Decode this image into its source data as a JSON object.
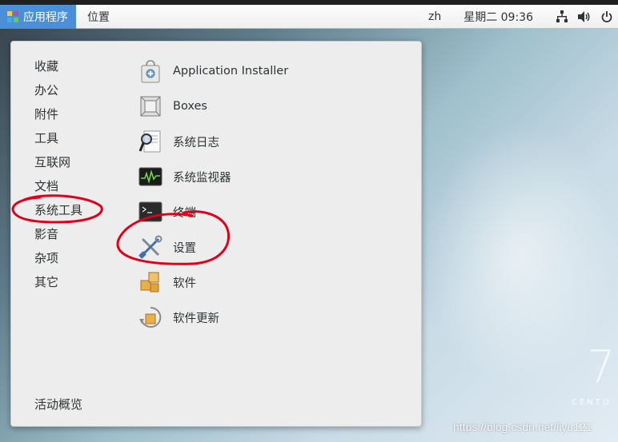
{
  "top_bar": {
    "apps_label": "应用程序",
    "places_label": "位置",
    "language": "zh",
    "clock": "星期二 09:36"
  },
  "categories": [
    "收藏",
    "办公",
    "附件",
    "工具",
    "互联网",
    "文档",
    "系统工具",
    "影音",
    "杂项",
    "其它"
  ],
  "apps": [
    {
      "label": "Application Installer",
      "icon": "application-installer-icon"
    },
    {
      "label": "Boxes",
      "icon": "boxes-icon"
    },
    {
      "label": "系统日志",
      "icon": "system-log-icon"
    },
    {
      "label": "系统监视器",
      "icon": "system-monitor-icon"
    },
    {
      "label": "终端",
      "icon": "terminal-icon"
    },
    {
      "label": "设置",
      "icon": "settings-icon"
    },
    {
      "label": "软件",
      "icon": "software-icon"
    },
    {
      "label": "软件更新",
      "icon": "software-update-icon"
    }
  ],
  "overview_label": "活动概览",
  "desktop": {
    "logo_number": "7",
    "logo_text": "CENTO"
  },
  "watermark": "https://blog.csdn.net/liyu121",
  "colors": {
    "accent": "#4a90d9",
    "annotation": "#e0001a"
  }
}
